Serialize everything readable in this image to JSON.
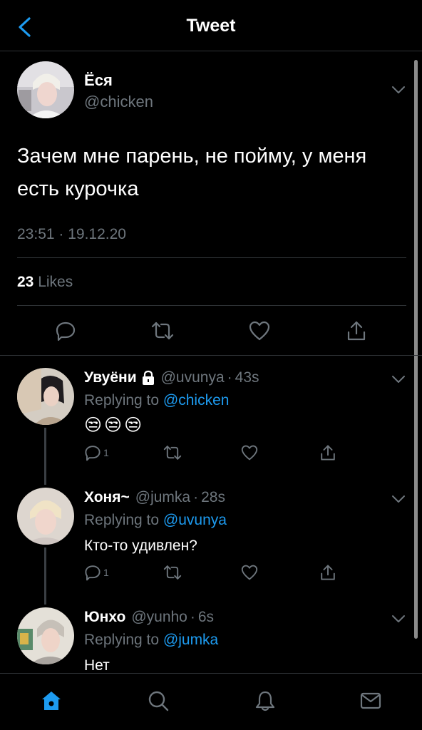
{
  "header": {
    "title": "Tweet"
  },
  "tweet": {
    "name": "Ёся",
    "handle": "@chicken",
    "text": "Зачем мне парень, не пойму, у меня есть курочка",
    "timestamp": "23:51 · 19.12.20",
    "likes_count": "23",
    "likes_label": "Likes"
  },
  "replies": [
    {
      "name": "Увуёни",
      "locked": true,
      "handle": "@uvunya",
      "dot": "·",
      "time": "43s",
      "replying_prefix": "Replying to",
      "replying_to": "@chicken",
      "emoji": [
        "😒",
        "😒",
        "😒"
      ],
      "reply_count": "1"
    },
    {
      "name": "Хоня~",
      "handle": "@jumka",
      "dot": "·",
      "time": "28s",
      "replying_prefix": "Replying to",
      "replying_to": "@uvunya",
      "text": "Кто-то удивлен?",
      "reply_count": "1"
    },
    {
      "name": "Юнхо",
      "handle": "@yunho",
      "dot": "·",
      "time": "6s",
      "replying_prefix": "Replying to",
      "replying_to": "@jumka",
      "text": "Нет"
    }
  ],
  "colors": {
    "accent": "#1d9bf0",
    "muted": "#6e767d",
    "divider": "#2f3336",
    "background": "#000000"
  },
  "icons": [
    "back-icon",
    "chevron-down-icon",
    "reply-icon",
    "retweet-icon",
    "like-icon",
    "share-icon",
    "lock-icon",
    "home-icon",
    "search-icon",
    "notifications-icon",
    "messages-icon"
  ]
}
